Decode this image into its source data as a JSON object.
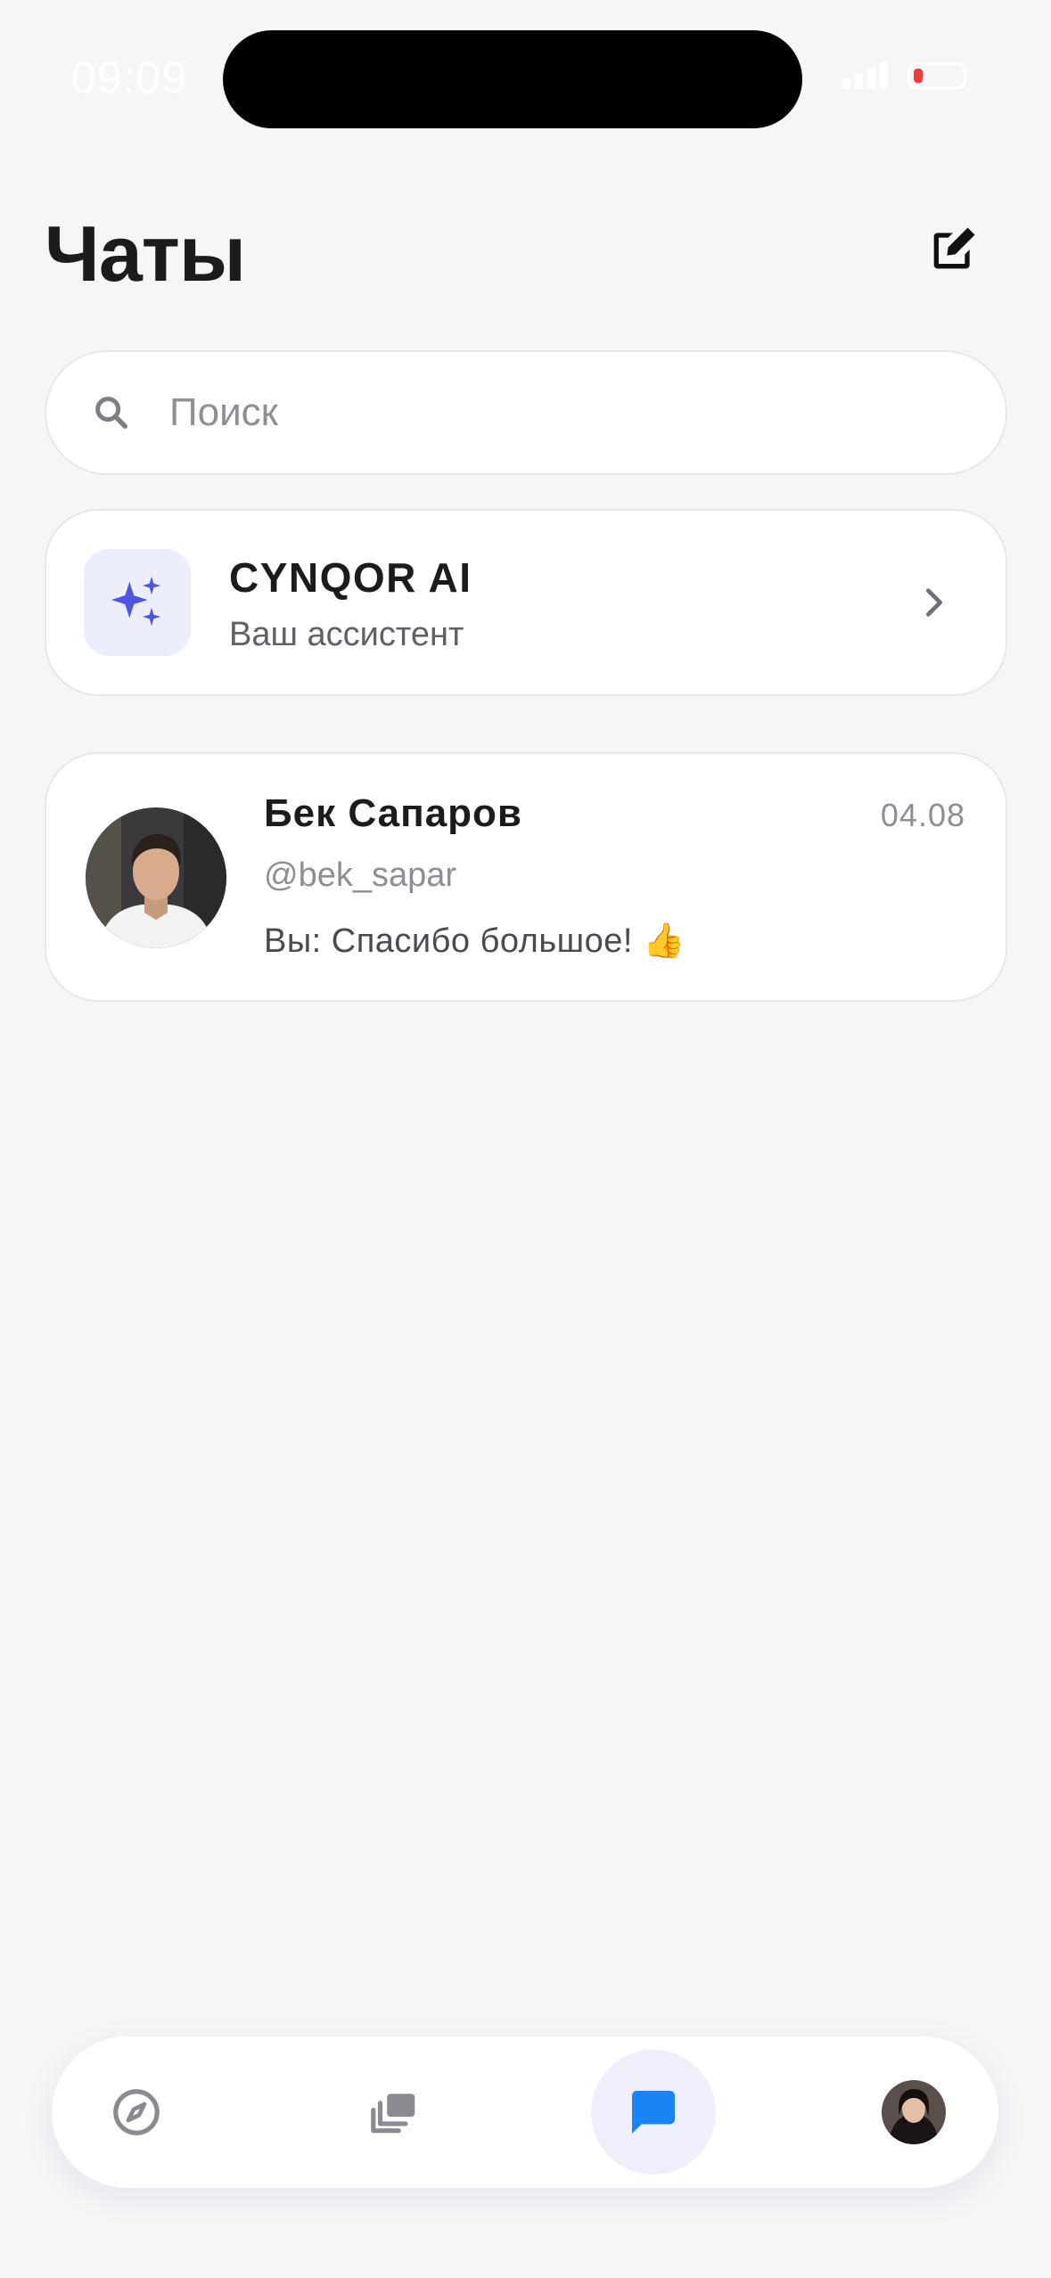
{
  "status_bar": {
    "time": "09:09",
    "battery_level": 0.15,
    "battery_color": "#ef3b3b"
  },
  "header": {
    "title": "Чаты",
    "compose_icon": "compose-icon"
  },
  "search": {
    "placeholder": "Поиск",
    "value": "",
    "icon": "search-icon"
  },
  "assistant": {
    "name": "CYNQOR AI",
    "subtitle": "Ваш ассистент",
    "icon": "sparkles-icon",
    "accent": "#4f55e0",
    "icon_bg": "#eceefe"
  },
  "chats": [
    {
      "name": "Бек Сапаров",
      "handle": "@bek_sapar",
      "date": "04.08",
      "preview": "Вы: Спасибо большое! 👍",
      "avatar": "user-avatar"
    }
  ],
  "bottom_nav": {
    "items": [
      {
        "name": "explore",
        "icon": "compass-icon",
        "active": false
      },
      {
        "name": "gallery",
        "icon": "stack-icon",
        "active": false
      },
      {
        "name": "chats",
        "icon": "chat-bubble-icon",
        "active": true
      },
      {
        "name": "profile",
        "icon": "profile-avatar",
        "active": false
      }
    ],
    "active_color": "#1a84f5",
    "inactive_color": "#8a8a90"
  }
}
